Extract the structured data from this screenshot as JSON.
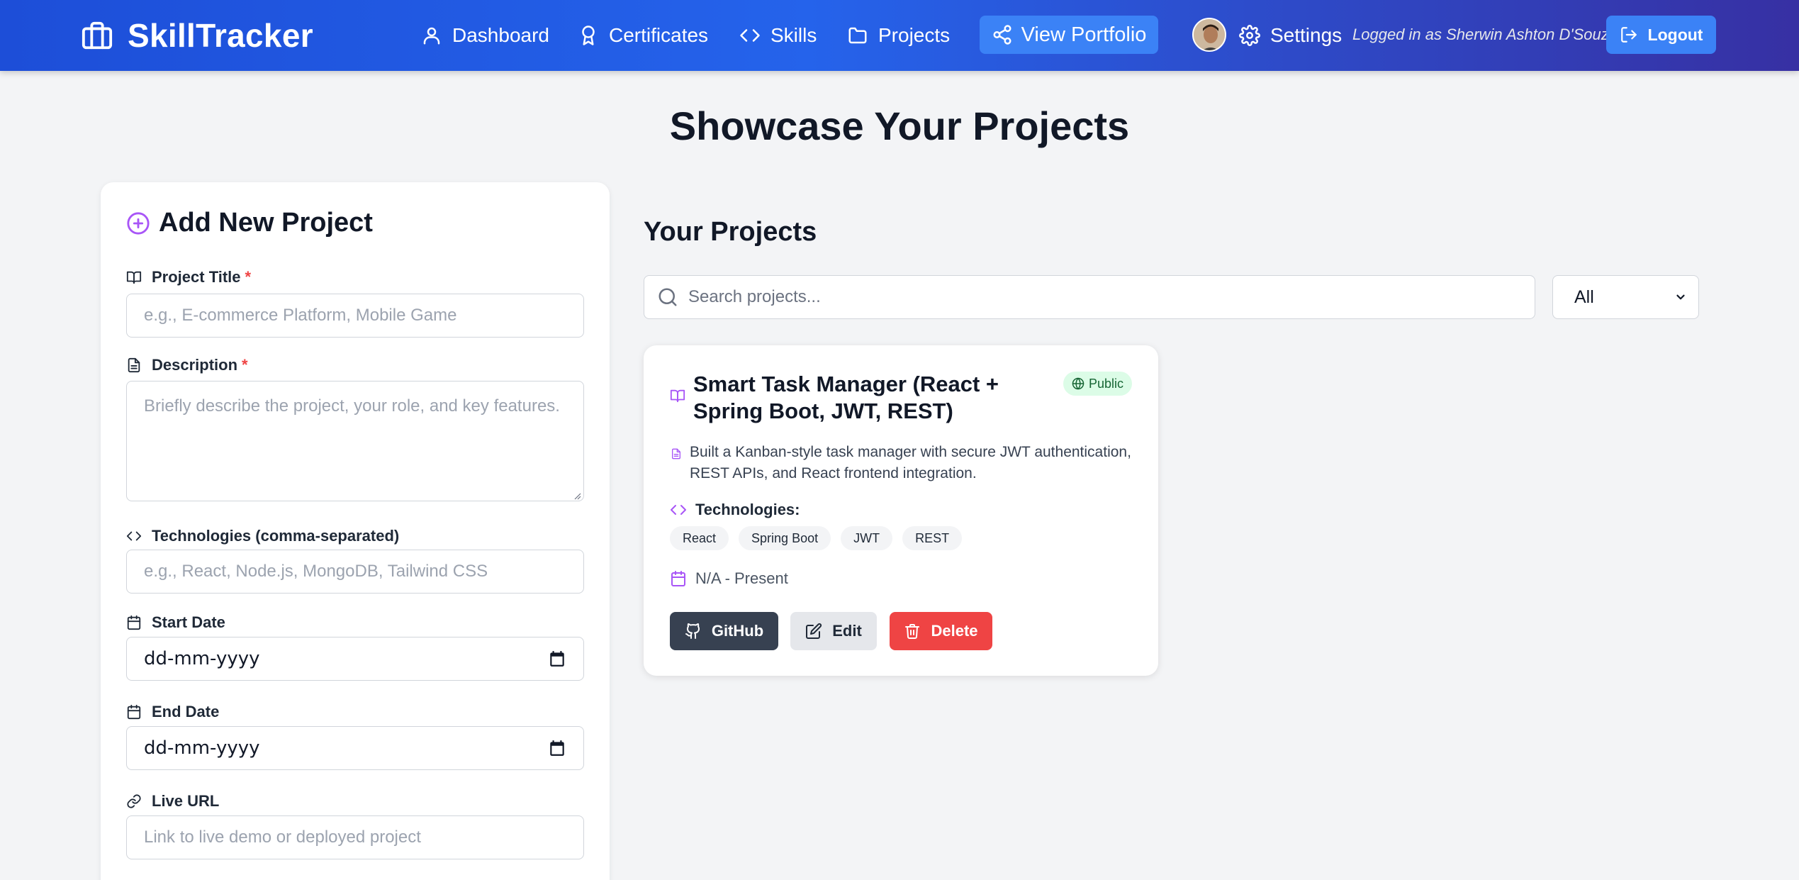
{
  "nav": {
    "brand": "SkillTracker",
    "links": [
      "Dashboard",
      "Certificates",
      "Skills",
      "Projects"
    ],
    "portfolio_button": "View Portfolio",
    "settings": "Settings",
    "logged_in_text": "Logged in as Sherwin Ashton D'Souza",
    "logout": "Logout"
  },
  "page_title": "Showcase Your Projects",
  "form": {
    "heading": "Add New Project",
    "title_label": "Project Title",
    "required_mark": "*",
    "title_placeholder": "e.g., E-commerce Platform, Mobile Game",
    "description_label": "Description",
    "description_placeholder": "Briefly describe the project, your role, and key features.",
    "technologies_label": "Technologies (comma-separated)",
    "technologies_placeholder": "e.g., React, Node.js, MongoDB, Tailwind CSS",
    "start_date_label": "Start Date",
    "start_date_value": "dd-mm-yyyy",
    "end_date_label": "End Date",
    "end_date_value": "dd-mm-yyyy",
    "live_url_label": "Live URL",
    "live_url_placeholder": "Link to live demo or deployed project"
  },
  "projects": {
    "heading": "Your Projects",
    "search_placeholder": "Search projects...",
    "filter_value": "All",
    "items": [
      {
        "title": "Smart Task Manager (React + Spring Boot, JWT, REST)",
        "visibility": "Public",
        "description": "Built a Kanban-style task manager with secure JWT authentication, REST APIs, and React frontend integration.",
        "technologies_label": "Technologies:",
        "technologies": [
          "React",
          "Spring Boot",
          "JWT",
          "REST"
        ],
        "date_range": "N/A - Present",
        "github_label": "GitHub",
        "edit_label": "Edit",
        "delete_label": "Delete"
      }
    ]
  },
  "colors": {
    "nav_gradient_start": "#1d4ed8",
    "nav_gradient_end": "#3730a3",
    "accent_blue": "#3b82f6",
    "purple_icon": "#a855f7",
    "public_badge_bg": "#dcfce7",
    "delete_red": "#ef4444",
    "github_dark": "#374151"
  },
  "icons": [
    "briefcase-icon",
    "user-icon",
    "award-icon",
    "code-icon",
    "folder-icon",
    "share-icon",
    "gear-icon",
    "logout-icon",
    "plus-circle-icon",
    "book-icon",
    "file-text-icon",
    "calendar-icon",
    "link-icon",
    "search-icon",
    "chevron-down-icon",
    "globe-icon",
    "github-icon",
    "edit-icon",
    "trash-icon"
  ]
}
